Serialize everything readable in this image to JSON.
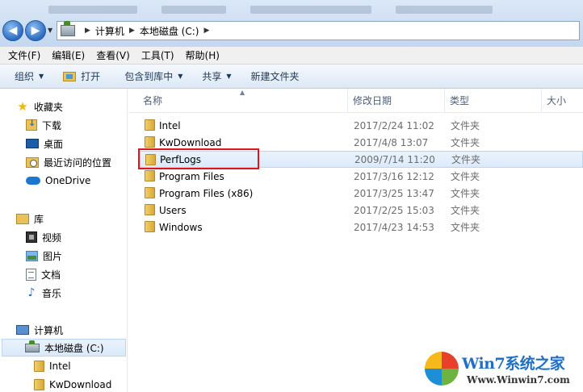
{
  "address": {
    "parts": [
      "计算机",
      "本地磁盘 (C:)"
    ]
  },
  "menu": [
    "文件(F)",
    "编辑(E)",
    "查看(V)",
    "工具(T)",
    "帮助(H)"
  ],
  "toolbar": {
    "organize": "组织",
    "open": "打开",
    "include_library": "包含到库中",
    "share": "共享",
    "new_folder": "新建文件夹"
  },
  "sidebar": {
    "favorites": "收藏夹",
    "downloads": "下载",
    "desktop": "桌面",
    "recent": "最近访问的位置",
    "onedrive": "OneDrive",
    "libraries": "库",
    "videos": "视频",
    "pictures": "图片",
    "documents": "文档",
    "music": "音乐",
    "computer": "计算机",
    "local_disk": "本地磁盘 (C:)",
    "intel": "Intel",
    "kwdownload": "KwDownload"
  },
  "columns": {
    "name": "名称",
    "modified": "修改日期",
    "type": "类型",
    "size": "大小"
  },
  "files": [
    {
      "name": "Intel",
      "date": "2017/2/24 11:02",
      "type": "文件夹"
    },
    {
      "name": "KwDownload",
      "date": "2017/4/8 13:07",
      "type": "文件夹"
    },
    {
      "name": "PerfLogs",
      "date": "2009/7/14 11:20",
      "type": "文件夹"
    },
    {
      "name": "Program Files",
      "date": "2017/3/16 12:12",
      "type": "文件夹"
    },
    {
      "name": "Program Files (x86)",
      "date": "2017/3/25 13:47",
      "type": "文件夹"
    },
    {
      "name": "Users",
      "date": "2017/2/25 15:03",
      "type": "文件夹"
    },
    {
      "name": "Windows",
      "date": "2017/4/23 14:53",
      "type": "文件夹"
    }
  ],
  "watermark": {
    "title": "Win7系统之家",
    "url": "Www.Winwin7.com"
  }
}
